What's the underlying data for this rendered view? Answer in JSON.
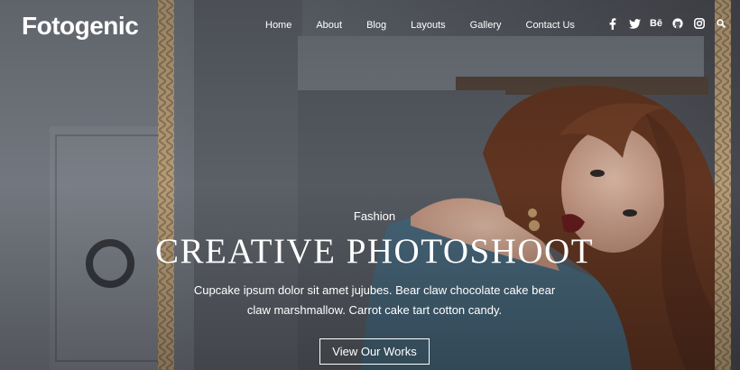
{
  "brand": {
    "logo_text": "Fotogenic"
  },
  "nav": {
    "items": [
      "Home",
      "About",
      "Blog",
      "Layouts",
      "Gallery",
      "Contact Us"
    ]
  },
  "social": {
    "icons": [
      "facebook-icon",
      "twitter-icon",
      "behance-icon",
      "github-icon",
      "instagram-icon",
      "search-icon"
    ],
    "behance_label": "Bē"
  },
  "hero": {
    "category": "Fashion",
    "title": "CREATIVE PHOTOSHOOT",
    "description": "Cupcake ipsum dolor sit amet jujubes. Bear claw chocolate cake bear claw marshmallow. Carrot cake tart cotton candy.",
    "cta_label": "View Our Works"
  },
  "colors": {
    "text": "#ffffff",
    "wall": "#6f7480",
    "sweater": "#4d6f84",
    "hair": "#6b3a24",
    "rope": "#c9b08a"
  }
}
